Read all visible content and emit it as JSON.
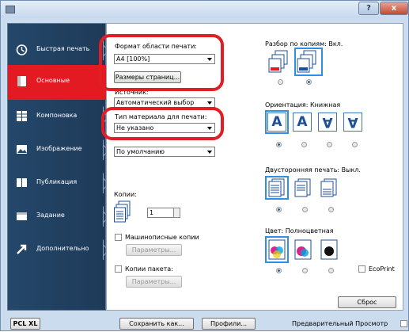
{
  "window": {
    "help_label": "?",
    "close_label": "x"
  },
  "sidebar": {
    "items": [
      {
        "label": "Быстрая печать",
        "icon": "quick-print-icon"
      },
      {
        "label": "Основные",
        "icon": "basic-icon"
      },
      {
        "label": "Компоновка",
        "icon": "layout-icon"
      },
      {
        "label": "Изображение",
        "icon": "image-icon"
      },
      {
        "label": "Публикация",
        "icon": "publishing-icon"
      },
      {
        "label": "Задание",
        "icon": "job-icon"
      },
      {
        "label": "Дополнительно",
        "icon": "advanced-icon"
      }
    ]
  },
  "left": {
    "print_size_label": "Формат области печати:",
    "print_size_value": "A4 [100%]",
    "page_sizes_button": "Размеры страниц...",
    "source_label": "Источник:",
    "source_value": "Автоматический выбор",
    "media_type_label": "Тип материала для печати:",
    "media_type_value": "Не указано",
    "default_value": "По умолчанию",
    "copies_label": "Копии:",
    "copies_value": "1",
    "mopy_label": "Машинописные копии",
    "mopy_params": "Параметры...",
    "pack_label": "Копии пакета:",
    "pack_params": "Параметры..."
  },
  "right": {
    "collate_label": "Разбор по копиям: Вкл.",
    "collate_icons": [
      "collate-off-icon",
      "collate-on-icon"
    ],
    "orientation_label": "Ориентация: Книжная",
    "orientation_glyphs": [
      "A",
      "A",
      "A",
      "A"
    ],
    "duplex_label": "Двусторонняя печать: Выкл.",
    "color_label": "Цвет: Полноцветная",
    "ecoprint_label": "EcoPrint",
    "reset_button": "Сброс"
  },
  "footer": {
    "pcl": "PCL XL",
    "save_as": "Сохранить как...",
    "profiles": "Профили...",
    "preview": "Предварительный Просмотр"
  },
  "colors": {
    "sidebar": "#24476a",
    "active": "#e31a22",
    "highlight": "#e01e26",
    "selected": "#2f8ee8"
  }
}
